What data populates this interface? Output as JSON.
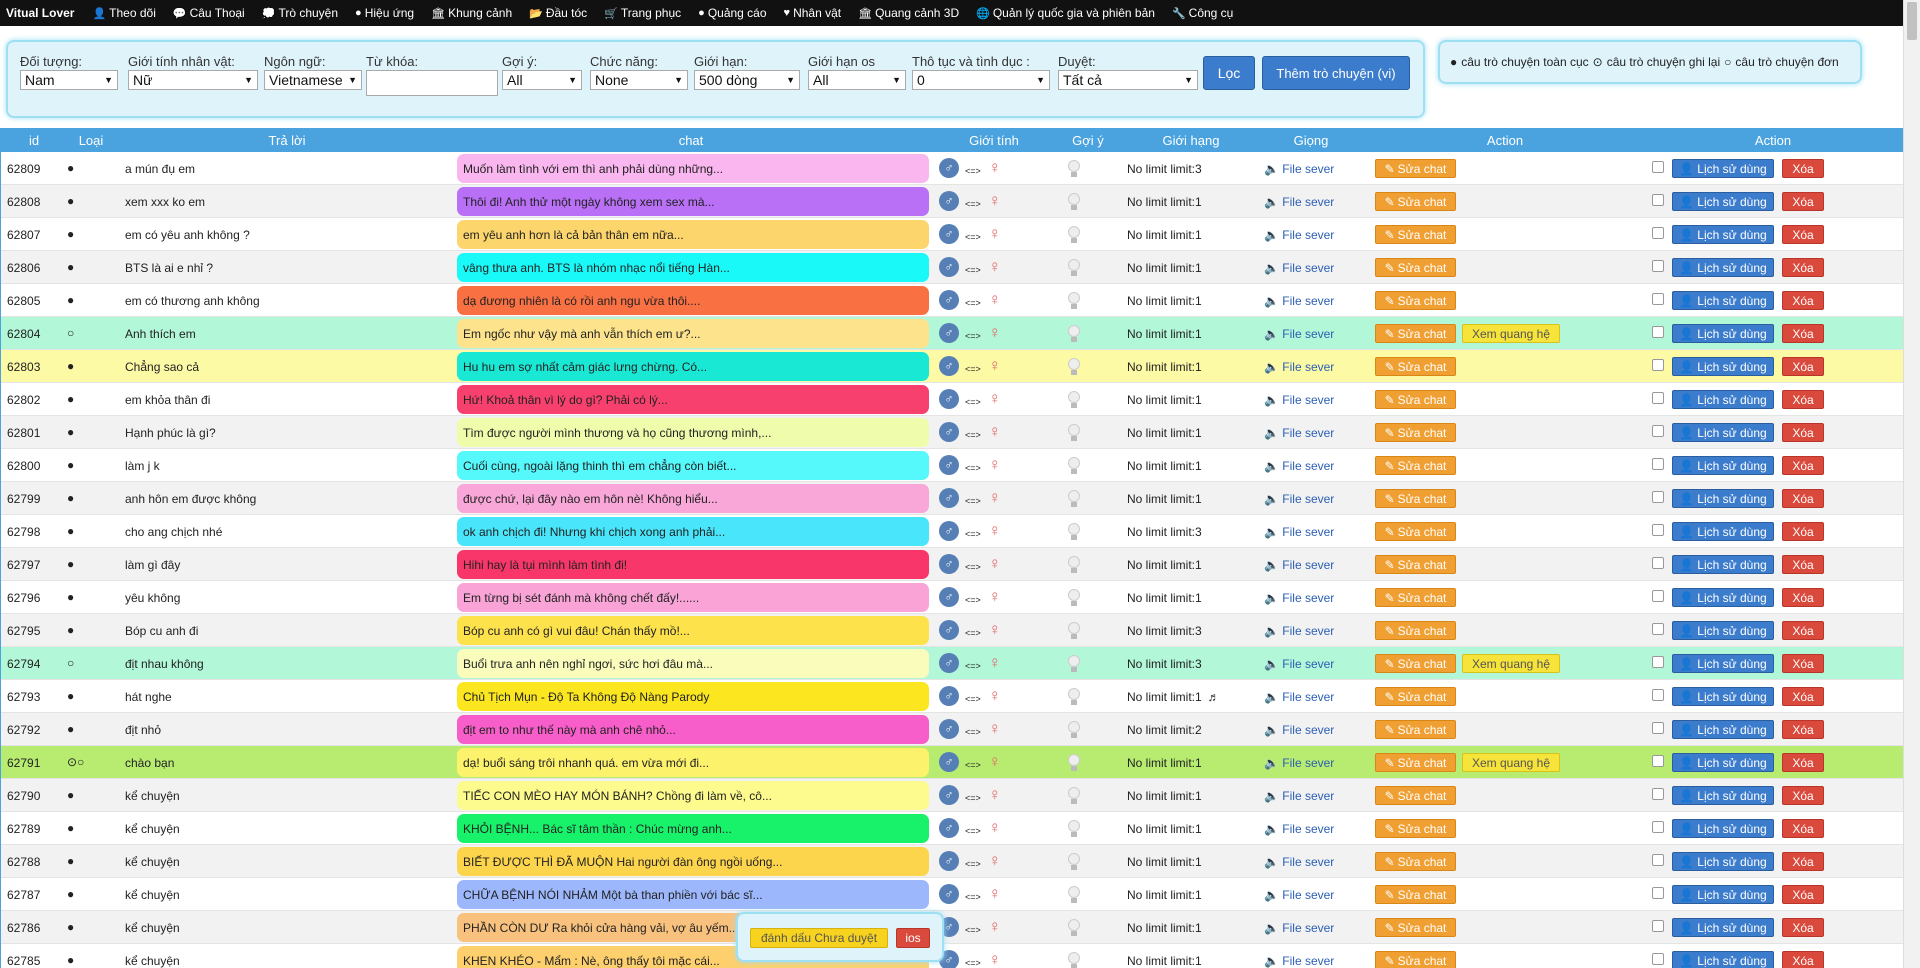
{
  "nav": {
    "brand": "Vitual Lover",
    "items": [
      {
        "icon": "user-icon",
        "glyph": "👤",
        "label": "Theo dõi"
      },
      {
        "icon": "comments-icon",
        "glyph": "💬",
        "label": "Câu Thoại"
      },
      {
        "icon": "chat-icon",
        "glyph": "💭",
        "label": "Trò chuyện"
      },
      {
        "icon": "circle-icon",
        "glyph": "●",
        "label": "Hiệu ứng"
      },
      {
        "icon": "bank-icon",
        "glyph": "🏛",
        "label": "Khung cảnh"
      },
      {
        "icon": "folder-icon",
        "glyph": "📂",
        "label": "Đầu tóc"
      },
      {
        "icon": "cart-icon",
        "glyph": "🛒",
        "label": "Trang phục"
      },
      {
        "icon": "circle-icon",
        "glyph": "●",
        "label": "Quảng cáo"
      },
      {
        "icon": "heart-icon",
        "glyph": "♥",
        "label": "Nhân vật"
      },
      {
        "icon": "bank-icon",
        "glyph": "🏛",
        "label": "Quang cảnh 3D"
      },
      {
        "icon": "globe-icon",
        "glyph": "🌐",
        "label": "Quản lý quốc gia và phiên bản"
      },
      {
        "icon": "wrench-icon",
        "glyph": "🔧",
        "label": "Công cụ"
      }
    ]
  },
  "filters": {
    "doi_tuong": {
      "label": "Đối tượng:",
      "value": "Nam"
    },
    "gioi_tinh": {
      "label": "Giới tính nhân vật:",
      "value": "Nữ"
    },
    "ngon_ngu": {
      "label": "Ngôn ngữ:",
      "value": "Vietnamese"
    },
    "tu_khoa": {
      "label": "Từ khóa:",
      "value": ""
    },
    "goi_y": {
      "label": "Gợi ý:",
      "value": "All"
    },
    "chuc_nang": {
      "label": "Chức năng:",
      "value": "None"
    },
    "gioi_han": {
      "label": "Giới hạn:",
      "value": "500 dòng"
    },
    "gioi_han_os": {
      "label": "Giới hạn os",
      "value": "All"
    },
    "tho_tuc": {
      "label": "Thô tục và tình dục :",
      "value": "0"
    },
    "duyet": {
      "label": "Duyệt:",
      "value": "Tất cả"
    },
    "filter_button": "Lọc",
    "add_button": "Thêm trò chuyện (vi)"
  },
  "radios": {
    "global": "câu trò chuyện toàn cục",
    "recorded": "câu trò chuyện ghi lại",
    "single": "câu trò chuyện đơn"
  },
  "table": {
    "headers": {
      "id": "id",
      "type": "Loại",
      "answer": "Trả lời",
      "chat": "chat",
      "gender": "Giới tính",
      "hint": "Gợi ý",
      "limit": "Giới hạng",
      "voice": "Giọng",
      "action1": "Action",
      "action2": "Action"
    },
    "arrow_text": "<=>",
    "voice_label": "File sever",
    "edit_label": "Sửa chat",
    "relation_label": "Xem quang hệ",
    "history_label": "Lịch sử dùng",
    "delete_label": "Xóa",
    "rows": [
      {
        "id": "62809",
        "type": "●",
        "answer": "a mún đụ em",
        "chat": "Muốn làm tình với em thì anh phải dùng những...",
        "chat_color": "#f9b6ef",
        "limit": "No limit limit:3",
        "bg": "",
        "rel": false,
        "note": ""
      },
      {
        "id": "62808",
        "type": "●",
        "answer": "xem xxx ko em",
        "chat": "Thôi đi! Anh thử một ngày không xem sex mà...",
        "chat_color": "#b970f6",
        "limit": "No limit limit:1",
        "bg": "alt",
        "rel": false,
        "note": ""
      },
      {
        "id": "62807",
        "type": "●",
        "answer": "em có yêu anh không ?",
        "chat": "em yêu anh hơn là cả bản thân em nữa...",
        "chat_color": "#fdd56d",
        "limit": "No limit limit:1",
        "bg": "",
        "rel": false,
        "note": ""
      },
      {
        "id": "62806",
        "type": "●",
        "answer": "BTS là ai e nhỉ ?",
        "chat": "vâng thưa anh. BTS là nhóm nhạc nổi tiếng Hàn...",
        "chat_color": "#19f9f7",
        "limit": "No limit limit:1",
        "bg": "alt",
        "rel": false,
        "note": ""
      },
      {
        "id": "62805",
        "type": "●",
        "answer": "em có thương anh không",
        "chat": "dạ đương nhiên là có rồi anh ngu vừa thôi....",
        "chat_color": "#f97043",
        "limit": "No limit limit:1",
        "bg": "",
        "rel": false,
        "note": ""
      },
      {
        "id": "62804",
        "type": "○",
        "answer": "Anh thích em",
        "chat": "Em ngốc như vậy mà anh vẫn thích em ư?...",
        "chat_color": "#fde38c",
        "limit": "No limit limit:1",
        "bg": "green",
        "rel": true,
        "note": ""
      },
      {
        "id": "62803",
        "type": "●",
        "answer": "Chẳng sao cả",
        "chat": "Hu hu em sợ nhất cảm giác lưng chừng. Có...",
        "chat_color": "#19e8d4",
        "limit": "No limit limit:1",
        "bg": "yellow",
        "rel": false,
        "note": ""
      },
      {
        "id": "62802",
        "type": "●",
        "answer": "em khỏa thân đi",
        "chat": "Hứ! Khoả thân vì lý do gì? Phải có lý...",
        "chat_color": "#f7406d",
        "limit": "No limit limit:1",
        "bg": "",
        "rel": false,
        "note": ""
      },
      {
        "id": "62801",
        "type": "●",
        "answer": "Hạnh phúc là gì?",
        "chat": "Tìm được người mình thương và họ cũng thương mình,...",
        "chat_color": "#eefcac",
        "limit": "No limit limit:1",
        "bg": "alt",
        "rel": false,
        "note": ""
      },
      {
        "id": "62800",
        "type": "●",
        "answer": "làm j k",
        "chat": "Cuối cùng, ngoài lặng thinh thì em chẳng còn biết...",
        "chat_color": "#55f8fb",
        "limit": "No limit limit:1",
        "bg": "",
        "rel": false,
        "note": ""
      },
      {
        "id": "62799",
        "type": "●",
        "answer": "anh hôn em được không",
        "chat": "được chứ, lại đây nào em hôn nè! Không hiểu...",
        "chat_color": "#f8a7d8",
        "limit": "No limit limit:1",
        "bg": "alt",
        "rel": false,
        "note": ""
      },
      {
        "id": "62798",
        "type": "●",
        "answer": "cho ang chịch nhé",
        "chat": "ok anh chịch đi! Nhưng khi chịch xong anh phải...",
        "chat_color": "#49e6fb",
        "limit": "No limit limit:3",
        "bg": "",
        "rel": false,
        "note": ""
      },
      {
        "id": "62797",
        "type": "●",
        "answer": "làm gì đây",
        "chat": "Hihi hay là tụi mình làm tình đi!",
        "chat_color": "#f8366a",
        "limit": "No limit limit:1",
        "bg": "alt",
        "rel": false,
        "note": ""
      },
      {
        "id": "62796",
        "type": "●",
        "answer": "yêu không",
        "chat": "Em từng bị sét đánh mà không chết đấy!......",
        "chat_color": "#f9a3d6",
        "limit": "No limit limit:1",
        "bg": "",
        "rel": false,
        "note": ""
      },
      {
        "id": "62795",
        "type": "●",
        "answer": "Bóp cu anh đi",
        "chat": "Bóp cu anh có gì vui đâu! Chán thấy mồ!...",
        "chat_color": "#fde24c",
        "limit": "No limit limit:3",
        "bg": "alt",
        "rel": false,
        "note": ""
      },
      {
        "id": "62794",
        "type": "○",
        "answer": "địt nhau không",
        "chat": "Buổi trưa anh nên nghỉ ngơi, sức hơi đâu mà...",
        "chat_color": "#f9fcbb",
        "limit": "No limit limit:3",
        "bg": "green",
        "rel": true,
        "note": ""
      },
      {
        "id": "62793",
        "type": "●",
        "answer": "hát nghe",
        "chat": "Chủ Tịch Mụn - Độ Ta Không Độ Nàng Parody",
        "chat_color": "#fbe620",
        "limit": "No limit limit:1",
        "bg": "",
        "rel": false,
        "note": "♬"
      },
      {
        "id": "62792",
        "type": "●",
        "answer": "địt nhỏ",
        "chat": "địt em to như thế này mà anh chê nhỏ...",
        "chat_color": "#f75eca",
        "limit": "No limit limit:2",
        "bg": "alt",
        "rel": false,
        "note": ""
      },
      {
        "id": "62791",
        "type": "⊙○",
        "answer": "chào bạn",
        "chat": "dạ! buổi sáng trôi nhanh quá. em vừa mới đi...",
        "chat_color": "#fdf26b",
        "limit": "No limit limit:1",
        "bg": "lime",
        "rel": true,
        "note": ""
      },
      {
        "id": "62790",
        "type": "●",
        "answer": "kể chuyện",
        "chat": "TIẾC CON MÈO HAY MÓN BÁNH? Chồng đi làm về, cô...",
        "chat_color": "#fdfb8d",
        "limit": "No limit limit:1",
        "bg": "alt",
        "rel": false,
        "note": ""
      },
      {
        "id": "62789",
        "type": "●",
        "answer": "kể chuyện",
        "chat": "KHỎI BỆNH... Bác sĩ tâm thần : Chúc mừng anh...",
        "chat_color": "#17f26a",
        "limit": "No limit limit:1",
        "bg": "",
        "rel": false,
        "note": ""
      },
      {
        "id": "62788",
        "type": "●",
        "answer": "kể chuyện",
        "chat": "BIẾT ĐƯỢC THÌ ĐÃ MUỘN Hai người đàn ông ngồi uống...",
        "chat_color": "#fdd54d",
        "limit": "No limit limit:1",
        "bg": "alt",
        "rel": false,
        "note": ""
      },
      {
        "id": "62787",
        "type": "●",
        "answer": "kể chuyện",
        "chat": "CHỮA BỆNH NÓI NHẢM Một bà than phiền với bác sĩ...",
        "chat_color": "#9cb7fb",
        "limit": "No limit limit:1",
        "bg": "",
        "rel": false,
        "note": ""
      },
      {
        "id": "62786",
        "type": "●",
        "answer": "kể chuyện",
        "chat": "PHẦN CÒN DƯ Ra khỏi cửa hàng vải, vợ âu yếm...",
        "chat_color": "#f8c27e",
        "limit": "No limit limit:1",
        "bg": "alt",
        "rel": false,
        "note": ""
      },
      {
        "id": "62785",
        "type": "●",
        "answer": "kể chuyện",
        "chat": "KHEN KHÉO - Mẩm : Nè, ông thấy tôi mặc cái...",
        "chat_color": "#fdcf6d",
        "limit": "No limit limit:1",
        "bg": "",
        "rel": false,
        "note": ""
      }
    ]
  },
  "popup": {
    "mark_label": "đánh dấu Chưa duyệt",
    "ios_label": "ios"
  }
}
